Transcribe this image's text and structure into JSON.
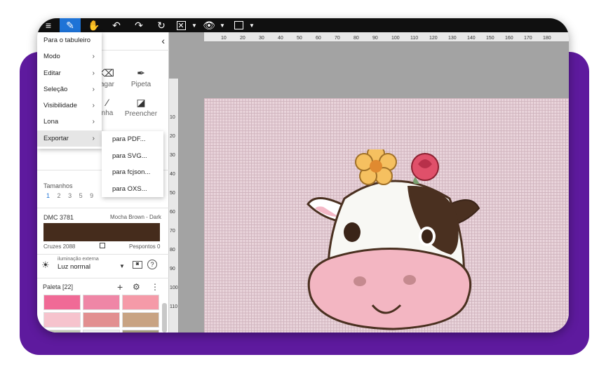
{
  "menu": {
    "items": [
      {
        "label": "Para o tabuleiro",
        "has_submenu": false
      },
      {
        "label": "Modo",
        "has_submenu": true
      },
      {
        "label": "Editar",
        "has_submenu": true
      },
      {
        "label": "Seleção",
        "has_submenu": true
      },
      {
        "label": "Visibilidade",
        "has_submenu": true
      },
      {
        "label": "Lona",
        "has_submenu": true
      },
      {
        "label": "Exportar",
        "has_submenu": true
      }
    ],
    "export_submenu": [
      "para PDF...",
      "para SVG...",
      "para fcjson...",
      "para OXS..."
    ]
  },
  "tools": {
    "row1": [
      {
        "label": "agar",
        "icon": "eraser-icon"
      },
      {
        "label": "Pipeta",
        "icon": "eyedropper-icon"
      }
    ],
    "row2": [
      {
        "label": "nha",
        "icon": "line-icon"
      },
      {
        "label": "Preencher",
        "icon": "fill-bucket-icon"
      }
    ]
  },
  "sizes": {
    "label": "Tamanhos",
    "values": [
      "1",
      "2",
      "3",
      "5",
      "9"
    ],
    "selected": "1"
  },
  "color": {
    "code": "DMC 3781",
    "name": "Mocha Brown - Dark",
    "hex": "#452c1c",
    "crosses": "Cruzes 2088",
    "backstitches": "Pespontos 0"
  },
  "lighting": {
    "label": "iluminação externa",
    "value": "Luz normal"
  },
  "palette": {
    "title": "Paleta [22]",
    "colors": [
      "#f06a96",
      "#ef86a6",
      "#f59aa8",
      "#f6c3cd",
      "#e28f90",
      "#c8a383",
      "#c2c9b6",
      "#eceeec",
      "#a39b7c",
      "#f0f0f0",
      "#e8495b",
      "#f0c040"
    ]
  },
  "ruler": {
    "top_labels": [
      "10",
      "20",
      "30",
      "40",
      "50",
      "60",
      "70",
      "80",
      "90",
      "100",
      "110",
      "120",
      "130",
      "140",
      "150",
      "160",
      "170",
      "180"
    ],
    "left_labels": [
      "10",
      "20",
      "30",
      "40",
      "50",
      "60",
      "70",
      "80",
      "90",
      "100",
      "110"
    ]
  },
  "colors": {
    "accent": "#1e73d6",
    "frame": "#5e1a9e",
    "toolbar": "#101010",
    "canvas_bg": "#ead5dc"
  }
}
